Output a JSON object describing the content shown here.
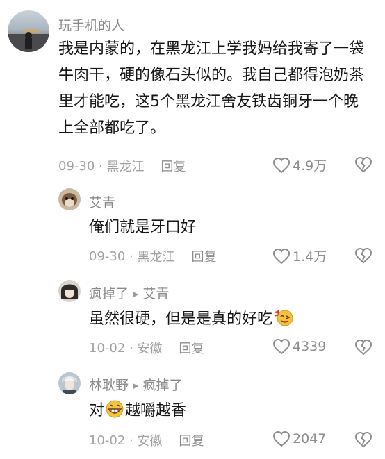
{
  "comments": [
    {
      "user": "玩手机的人",
      "text": "我是内蒙的，在黑龙江上学我妈给我寄了一袋牛肉干，硬的像石头似的。我自己都得泡奶茶里才能吃，这5个黑龙江舍友铁齿铜牙一个晚上全部都吃了。",
      "date": "09-30",
      "location": "黑龙江",
      "reply_label": "回复",
      "likes": "4.9万"
    }
  ],
  "replies": [
    {
      "user": "艾青",
      "reply_to": "",
      "text": "俺们就是牙口好",
      "date": "09-30",
      "location": "黑龙江",
      "reply_label": "回复",
      "likes": "1.4万"
    },
    {
      "user": "疯掉了",
      "reply_to": "艾青",
      "text": "虽然很硬，但是是真的好吃",
      "emoji": "yummy-emoji",
      "date": "10-02",
      "location": "安徽",
      "reply_label": "回复",
      "likes": "4339"
    },
    {
      "user": "林耿野",
      "reply_to": "疯掉了",
      "text_before": "对",
      "emoji": "grin-emoji",
      "text_after": "越嚼越香",
      "date": "10-02",
      "location": "安徽",
      "reply_label": "回复",
      "likes": "2047"
    }
  ],
  "meta_separator": " · "
}
